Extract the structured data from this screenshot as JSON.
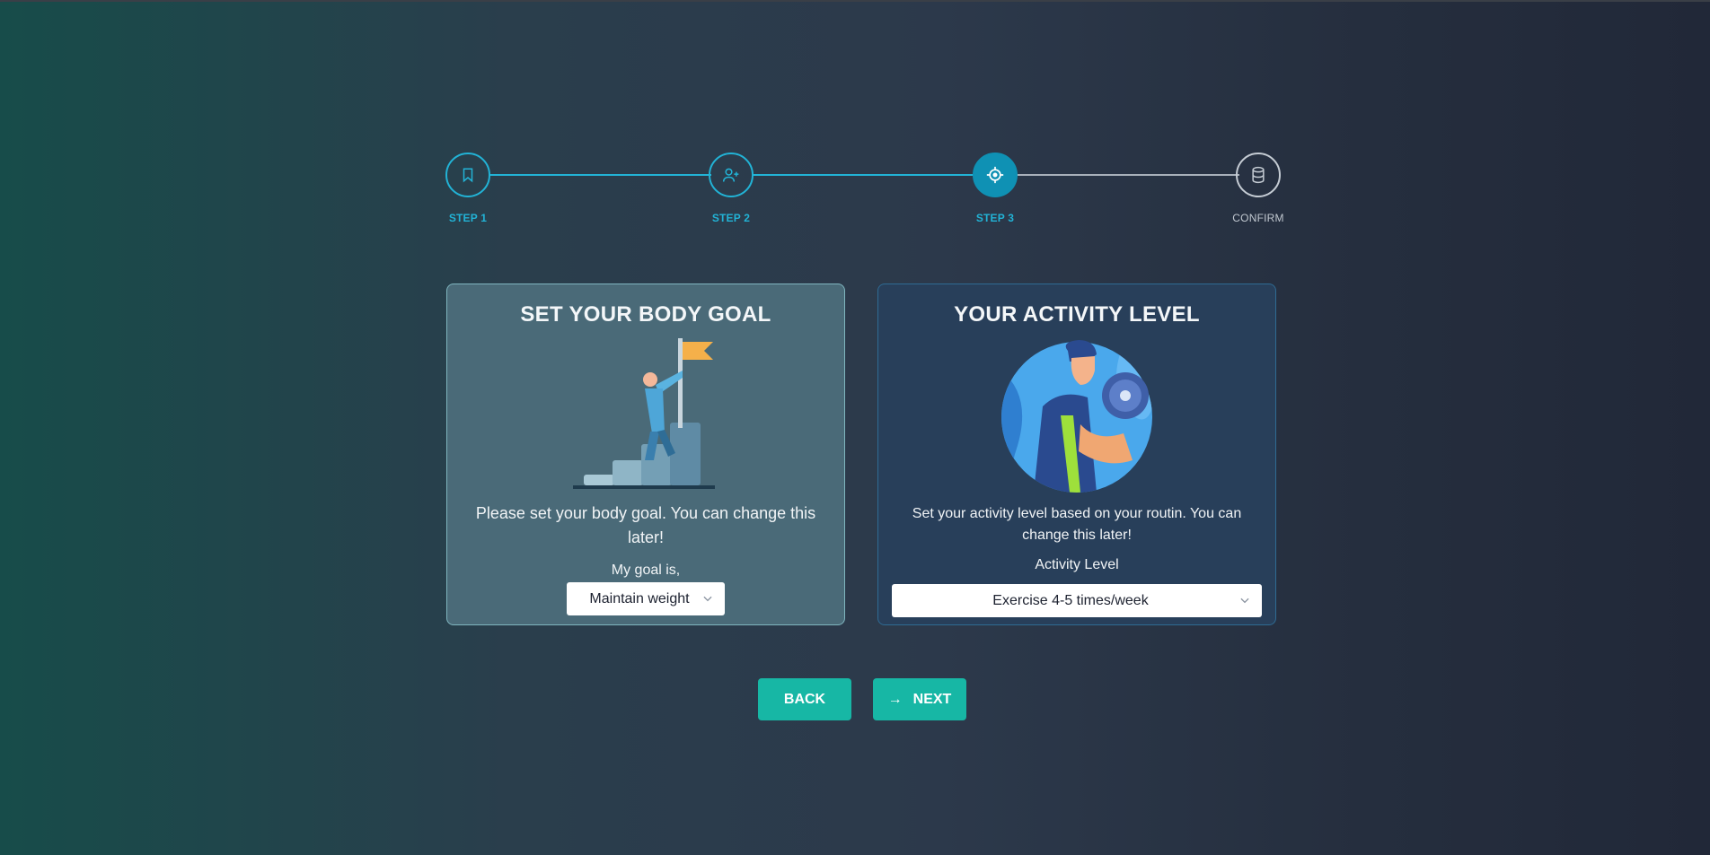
{
  "stepper": {
    "steps": [
      {
        "label": "STEP 1",
        "icon": "bookmark-icon",
        "state": "done"
      },
      {
        "label": "STEP 2",
        "icon": "user-plus-icon",
        "state": "done"
      },
      {
        "label": "STEP 3",
        "icon": "target-icon",
        "state": "active"
      },
      {
        "label": "CONFIRM",
        "icon": "database-icon",
        "state": "todo"
      }
    ]
  },
  "goal_card": {
    "title": "SET YOUR BODY GOAL",
    "description": "Please set your body goal. You can change this later!",
    "field_label": "My goal is,",
    "selected": "Maintain weight"
  },
  "activity_card": {
    "title": "YOUR ACTIVITY LEVEL",
    "description": "Set your activity level based on your routin. You can change this later!",
    "field_label": "Activity Level",
    "selected": "Exercise 4-5 times/week"
  },
  "buttons": {
    "back_label": "BACK",
    "next_label": "NEXT"
  },
  "colors": {
    "accent": "#22b3d6",
    "active_step": "#0f91b4",
    "button": "#17b7a5"
  }
}
